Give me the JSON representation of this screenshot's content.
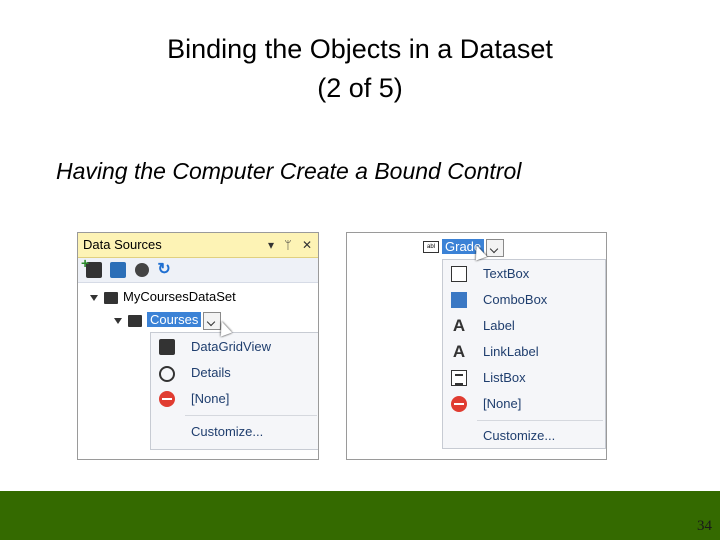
{
  "slide": {
    "title_line1": "Binding the Objects in a Dataset",
    "title_line2": "(2 of 5)",
    "subtitle": "Having the Computer Create a Bound Control",
    "page_number": "34"
  },
  "left_panel": {
    "header_title": "Data Sources",
    "header_controls": [
      "▾",
      "ᛘ",
      "✕"
    ],
    "toolbar_icons": [
      "add-data-source-icon",
      "edit-dataset-icon",
      "configure-dataset-icon",
      "refresh-icon"
    ],
    "tree": {
      "dataset_label": "MyCoursesDataSet",
      "table_label": "Courses"
    },
    "menu_items": [
      {
        "label": "DataGridView",
        "icon": "datagridview-icon"
      },
      {
        "label": "Details",
        "icon": "details-icon"
      },
      {
        "label": "[None]",
        "icon": "none-icon"
      }
    ],
    "customize_label": "Customize..."
  },
  "right_panel": {
    "field_label": "Grade",
    "menu_items": [
      {
        "label": "TextBox",
        "icon": "textbox-icon"
      },
      {
        "label": "ComboBox",
        "icon": "combobox-icon"
      },
      {
        "label": "Label",
        "icon": "label-icon"
      },
      {
        "label": "LinkLabel",
        "icon": "linklabel-icon"
      },
      {
        "label": "ListBox",
        "icon": "listbox-icon"
      },
      {
        "label": "[None]",
        "icon": "none-icon"
      }
    ],
    "customize_label": "Customize..."
  },
  "colors": {
    "footer_green": "#346a00",
    "header_yellow": "#fdf3b5",
    "selection_blue": "#3b82d6",
    "menu_text": "#1f3e6e"
  }
}
